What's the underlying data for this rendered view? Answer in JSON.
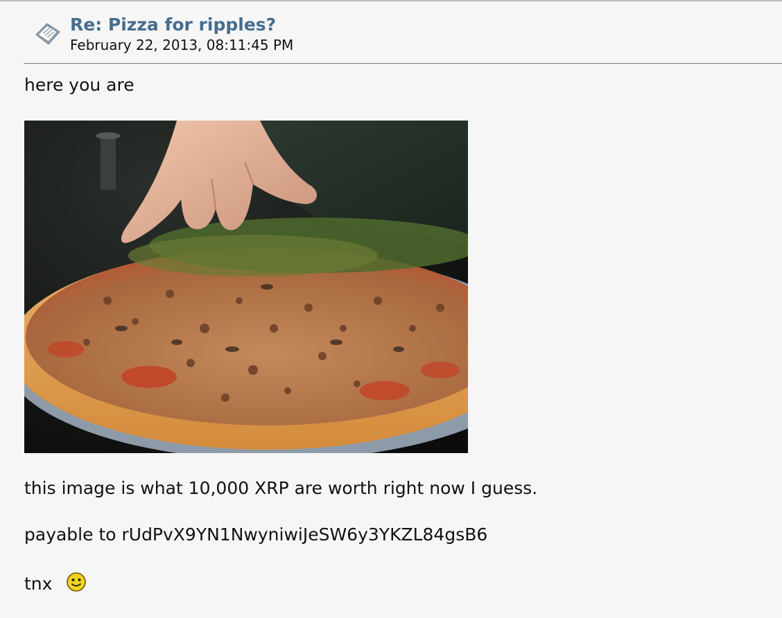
{
  "post": {
    "title": "Re: Pizza for ripples?",
    "date": "February 22, 2013, 08:11:45 PM",
    "icon": "message-icon"
  },
  "body": {
    "line1": "here you are",
    "image_icon": "pizza-photo",
    "line2": "this image is what 10,000 XRP are worth right now I guess.",
    "line3": "payable to rUdPvX9YN1NwyniwiJeSW6y3YKZL84gsB6",
    "line4": "tnx",
    "smiley_icon": "smiley-icon"
  },
  "colors": {
    "background": "#f6f6f6",
    "title": "#466d8d",
    "rule": "#7a7a7a",
    "smiley": "#f2d21b"
  }
}
